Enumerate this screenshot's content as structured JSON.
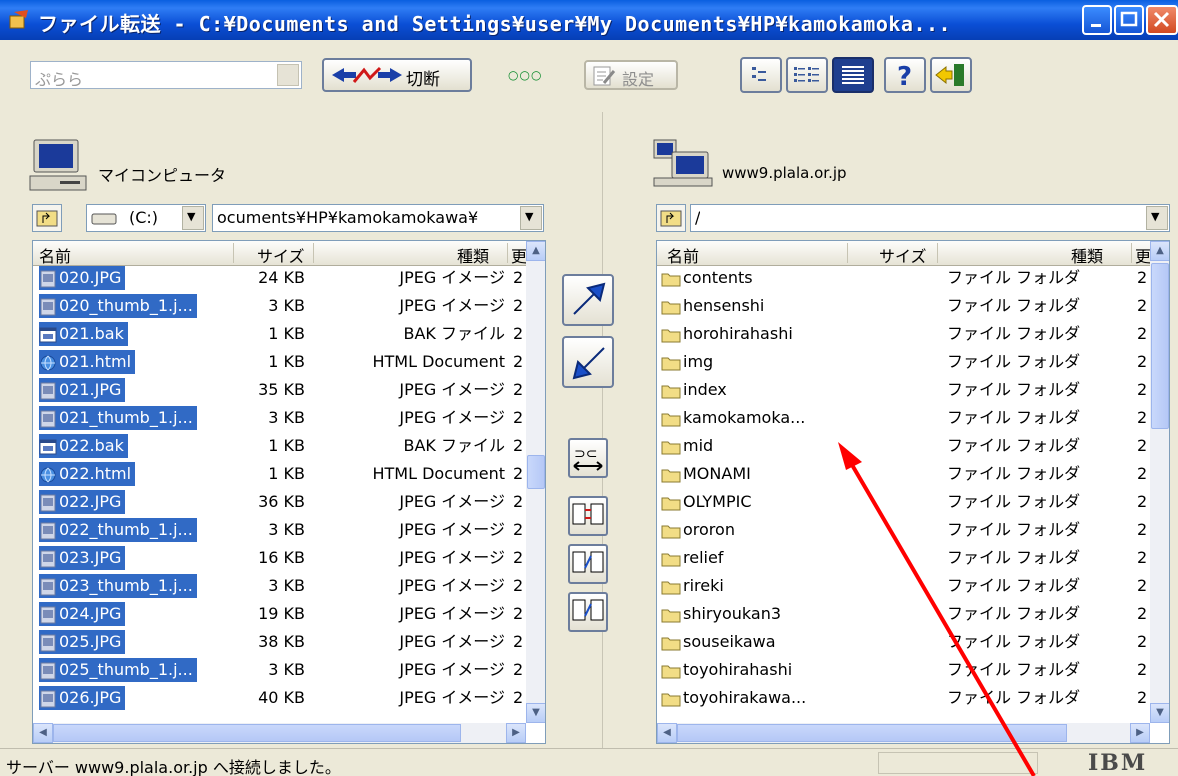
{
  "window": {
    "title": "ファイル転送 - C:¥Documents and Settings¥user¥My Documents¥HP¥kamokamoka...",
    "colors": {
      "titlebar": "#0b4fd6",
      "selection": "#316ac5",
      "annotation_arrow": "#ff0000"
    }
  },
  "toolbar": {
    "site_combo_value": "ぷらら",
    "disconnect_label": "切断",
    "status_dots": "○○○",
    "settings_label": "設定"
  },
  "local": {
    "title": "マイコンピュータ",
    "drive": "(C:)",
    "path": "ocuments¥HP¥kamokamokawa¥",
    "columns": {
      "name": "名前",
      "size": "サイズ",
      "type": "種類",
      "date": "更"
    },
    "files": [
      {
        "name": "020.JPG",
        "size": "24 KB",
        "type": "JPEG イメージ",
        "date": "2",
        "icon": "image-file-icon",
        "selected": true
      },
      {
        "name": "020_thumb_1.j...",
        "size": "3 KB",
        "type": "JPEG イメージ",
        "date": "2",
        "icon": "image-file-icon",
        "selected": true
      },
      {
        "name": "021.bak",
        "size": "1 KB",
        "type": "BAK ファイル",
        "date": "2",
        "icon": "bak-file-icon",
        "selected": true
      },
      {
        "name": "021.html",
        "size": "1 KB",
        "type": "HTML Document",
        "date": "2",
        "icon": "html-file-icon",
        "selected": true
      },
      {
        "name": "021.JPG",
        "size": "35 KB",
        "type": "JPEG イメージ",
        "date": "2",
        "icon": "image-file-icon",
        "selected": true
      },
      {
        "name": "021_thumb_1.j...",
        "size": "3 KB",
        "type": "JPEG イメージ",
        "date": "2",
        "icon": "image-file-icon",
        "selected": true
      },
      {
        "name": "022.bak",
        "size": "1 KB",
        "type": "BAK ファイル",
        "date": "2",
        "icon": "bak-file-icon",
        "selected": true
      },
      {
        "name": "022.html",
        "size": "1 KB",
        "type": "HTML Document",
        "date": "2",
        "icon": "html-file-icon",
        "selected": true
      },
      {
        "name": "022.JPG",
        "size": "36 KB",
        "type": "JPEG イメージ",
        "date": "2",
        "icon": "image-file-icon",
        "selected": true
      },
      {
        "name": "022_thumb_1.j...",
        "size": "3 KB",
        "type": "JPEG イメージ",
        "date": "2",
        "icon": "image-file-icon",
        "selected": true
      },
      {
        "name": "023.JPG",
        "size": "16 KB",
        "type": "JPEG イメージ",
        "date": "2",
        "icon": "image-file-icon",
        "selected": true
      },
      {
        "name": "023_thumb_1.j...",
        "size": "3 KB",
        "type": "JPEG イメージ",
        "date": "2",
        "icon": "image-file-icon",
        "selected": true
      },
      {
        "name": "024.JPG",
        "size": "19 KB",
        "type": "JPEG イメージ",
        "date": "2",
        "icon": "image-file-icon",
        "selected": true
      },
      {
        "name": "025.JPG",
        "size": "38 KB",
        "type": "JPEG イメージ",
        "date": "2",
        "icon": "image-file-icon",
        "selected": true
      },
      {
        "name": "025_thumb_1.j...",
        "size": "3 KB",
        "type": "JPEG イメージ",
        "date": "2",
        "icon": "image-file-icon",
        "selected": true
      },
      {
        "name": "026.JPG",
        "size": "40 KB",
        "type": "JPEG イメージ",
        "date": "2",
        "icon": "image-file-icon",
        "selected": true
      }
    ]
  },
  "remote": {
    "title": "www9.plala.or.jp",
    "path": "/",
    "columns": {
      "name": "名前",
      "size": "サイズ",
      "type": "種類",
      "date": "更"
    },
    "folders": [
      {
        "name": "contents",
        "type": "ファイル フォルダ",
        "date": "2"
      },
      {
        "name": "hensenshi",
        "type": "ファイル フォルダ",
        "date": "2"
      },
      {
        "name": "horohirahashi",
        "type": "ファイル フォルダ",
        "date": "2"
      },
      {
        "name": "img",
        "type": "ファイル フォルダ",
        "date": "2"
      },
      {
        "name": "index",
        "type": "ファイル フォルダ",
        "date": "2"
      },
      {
        "name": "kamokamoka...",
        "type": "ファイル フォルダ",
        "date": "2"
      },
      {
        "name": "mid",
        "type": "ファイル フォルダ",
        "date": "2"
      },
      {
        "name": "MONAMI",
        "type": "ファイル フォルダ",
        "date": "2"
      },
      {
        "name": "OLYMPIC",
        "type": "ファイル フォルダ",
        "date": "2"
      },
      {
        "name": "ororon",
        "type": "ファイル フォルダ",
        "date": "2"
      },
      {
        "name": "relief",
        "type": "ファイル フォルダ",
        "date": "2"
      },
      {
        "name": "rireki",
        "type": "ファイル フォルダ",
        "date": "2"
      },
      {
        "name": "shiryoukan3",
        "type": "ファイル フォルダ",
        "date": "2"
      },
      {
        "name": "souseikawa",
        "type": "ファイル フォルダ",
        "date": "2"
      },
      {
        "name": "toyohirahashi",
        "type": "ファイル フォルダ",
        "date": "2"
      },
      {
        "name": "toyohirakawa...",
        "type": "ファイル フォルダ",
        "date": "2"
      }
    ]
  },
  "statusbar": {
    "message": "サーバー www9.plala.or.jp へ接続しました。",
    "brand": "IBM"
  }
}
